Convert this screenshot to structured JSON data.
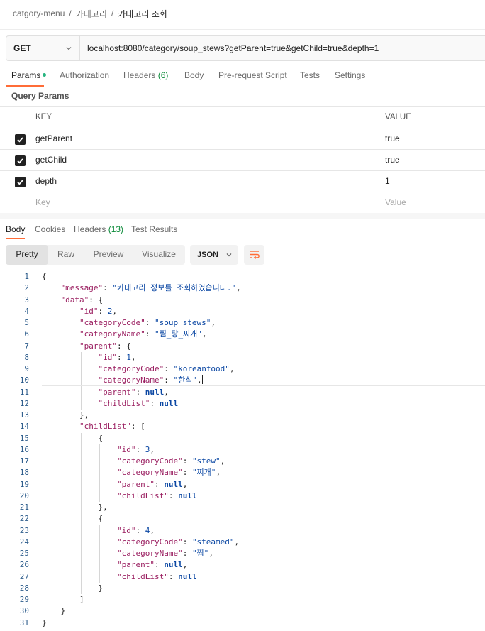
{
  "breadcrumb": {
    "items": [
      "catgory-menu",
      "카테고리"
    ],
    "separator": "/",
    "current": "카테고리 조회"
  },
  "request": {
    "method": "GET",
    "url": "localhost:8080/category/soup_stews?getParent=true&getChild=true&depth=1"
  },
  "request_tabs": [
    {
      "label": "Params",
      "active": true,
      "dot": true
    },
    {
      "label": "Authorization"
    },
    {
      "label": "Headers",
      "count": "(6)"
    },
    {
      "label": "Body"
    },
    {
      "label": "Pre-request Script"
    },
    {
      "label": "Tests"
    },
    {
      "label": "Settings"
    }
  ],
  "query_params": {
    "title": "Query Params",
    "columns": {
      "key": "KEY",
      "value": "VALUE"
    },
    "rows": [
      {
        "checked": true,
        "key": "getParent",
        "value": "true"
      },
      {
        "checked": true,
        "key": "getChild",
        "value": "true"
      },
      {
        "checked": true,
        "key": "depth",
        "value": "1"
      }
    ],
    "placeholder": {
      "key": "Key",
      "value": "Value"
    }
  },
  "response_tabs": [
    {
      "label": "Body",
      "active": true
    },
    {
      "label": "Cookies"
    },
    {
      "label": "Headers",
      "count": "(13)"
    },
    {
      "label": "Test Results"
    }
  ],
  "view_modes": [
    "Pretty",
    "Raw",
    "Preview",
    "Visualize"
  ],
  "active_view": "Pretty",
  "format": "JSON",
  "icons": {
    "dropdown": "chevron-down-icon",
    "wrap": "wrap-lines-icon",
    "check": "check-icon"
  },
  "colors": {
    "accent": "#ff6c37",
    "dot": "#26b47f",
    "json_key": "#9a1e60",
    "json_value": "#0b47a3"
  },
  "code_lines": [
    "{",
    "    \"message\": \"카테고리 정보를 조회하였습니다.\",",
    "    \"data\": {",
    "        \"id\": 2,",
    "        \"categoryCode\": \"soup_stews\",",
    "        \"categoryName\": \"찜_탕_찌개\",",
    "        \"parent\": {",
    "            \"id\": 1,",
    "            \"categoryCode\": \"koreanfood\",",
    "            \"categoryName\": \"한식\",",
    "            \"parent\": null,",
    "            \"childList\": null",
    "        },",
    "        \"childList\": [",
    "            {",
    "                \"id\": 3,",
    "                \"categoryCode\": \"stew\",",
    "                \"categoryName\": \"찌개\",",
    "                \"parent\": null,",
    "                \"childList\": null",
    "            },",
    "            {",
    "                \"id\": 4,",
    "                \"categoryCode\": \"steamed\",",
    "                \"categoryName\": \"찜\",",
    "                \"parent\": null,",
    "                \"childList\": null",
    "            }",
    "        ]",
    "    }",
    "}"
  ]
}
